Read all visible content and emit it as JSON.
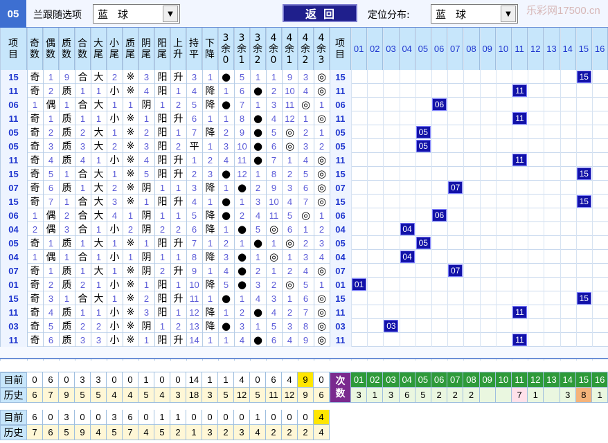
{
  "topbar": {
    "issue_num": "05",
    "follow_label": "兰跟随选项",
    "follow_value": "蓝球",
    "back_label": "返回",
    "position_label": "定位分布:",
    "position_value": "蓝球",
    "watermark": "乐彩网17500.cn"
  },
  "headers": [
    "项目",
    "奇数",
    "偶数",
    "质数",
    "合数",
    "大尾",
    "小尾",
    "质尾",
    "阴尾",
    "阳尾",
    "上升",
    "持平",
    "下降",
    "3余0",
    "3余1",
    "3余2",
    "4余0",
    "4余1",
    "4余2",
    "4余3",
    "项目"
  ],
  "dist_headers": [
    "01",
    "02",
    "03",
    "04",
    "05",
    "06",
    "07",
    "08",
    "09",
    "10",
    "11",
    "12",
    "13",
    "14",
    "15",
    "16"
  ],
  "rows": [
    {
      "n": "15",
      "v": [
        "奇",
        "1",
        "9",
        "合",
        "大",
        "2",
        "※",
        "3",
        "阳",
        "升",
        "3",
        "1",
        "●",
        "5",
        "1",
        "1",
        "9",
        "3",
        "◎"
      ]
    },
    {
      "n": "11",
      "v": [
        "奇",
        "2",
        "质",
        "1",
        "1",
        "小",
        "※",
        "4",
        "阳",
        "1",
        "4",
        "降",
        "1",
        "6",
        "●",
        "2",
        "10",
        "4",
        "◎"
      ]
    },
    {
      "n": "06",
      "v": [
        "1",
        "偶",
        "1",
        "合",
        "大",
        "1",
        "1",
        "阴",
        "1",
        "2",
        "5",
        "降",
        "●",
        "7",
        "1",
        "3",
        "11",
        "◎",
        "1"
      ]
    },
    {
      "n": "11",
      "v": [
        "奇",
        "1",
        "质",
        "1",
        "1",
        "小",
        "※",
        "1",
        "阳",
        "升",
        "6",
        "1",
        "1",
        "8",
        "●",
        "4",
        "12",
        "1",
        "◎"
      ]
    },
    {
      "n": "05",
      "v": [
        "奇",
        "2",
        "质",
        "2",
        "大",
        "1",
        "※",
        "2",
        "阳",
        "1",
        "7",
        "降",
        "2",
        "9",
        "●",
        "5",
        "◎",
        "2",
        "1"
      ]
    },
    {
      "n": "05",
      "v": [
        "奇",
        "3",
        "质",
        "3",
        "大",
        "2",
        "※",
        "3",
        "阳",
        "2",
        "平",
        "1",
        "3",
        "10",
        "●",
        "6",
        "◎",
        "3",
        "2"
      ]
    },
    {
      "n": "11",
      "v": [
        "奇",
        "4",
        "质",
        "4",
        "1",
        "小",
        "※",
        "4",
        "阳",
        "升",
        "1",
        "2",
        "4",
        "11",
        "●",
        "7",
        "1",
        "4",
        "◎"
      ]
    },
    {
      "n": "15",
      "v": [
        "奇",
        "5",
        "1",
        "合",
        "大",
        "1",
        "※",
        "5",
        "阳",
        "升",
        "2",
        "3",
        "●",
        "12",
        "1",
        "8",
        "2",
        "5",
        "◎"
      ]
    },
    {
      "n": "07",
      "v": [
        "奇",
        "6",
        "质",
        "1",
        "大",
        "2",
        "※",
        "阴",
        "1",
        "1",
        "3",
        "降",
        "1",
        "●",
        "2",
        "9",
        "3",
        "6",
        "◎"
      ]
    },
    {
      "n": "15",
      "v": [
        "奇",
        "7",
        "1",
        "合",
        "大",
        "3",
        "※",
        "1",
        "阳",
        "升",
        "4",
        "1",
        "●",
        "1",
        "3",
        "10",
        "4",
        "7",
        "◎"
      ]
    },
    {
      "n": "06",
      "v": [
        "1",
        "偶",
        "2",
        "合",
        "大",
        "4",
        "1",
        "阴",
        "1",
        "1",
        "5",
        "降",
        "●",
        "2",
        "4",
        "11",
        "5",
        "◎",
        "1"
      ]
    },
    {
      "n": "04",
      "v": [
        "2",
        "偶",
        "3",
        "合",
        "1",
        "小",
        "2",
        "阴",
        "2",
        "2",
        "6",
        "降",
        "1",
        "●",
        "5",
        "◎",
        "6",
        "1",
        "2"
      ]
    },
    {
      "n": "05",
      "v": [
        "奇",
        "1",
        "质",
        "1",
        "大",
        "1",
        "※",
        "1",
        "阳",
        "升",
        "7",
        "1",
        "2",
        "1",
        "●",
        "1",
        "◎",
        "2",
        "3"
      ]
    },
    {
      "n": "04",
      "v": [
        "1",
        "偶",
        "1",
        "合",
        "1",
        "小",
        "1",
        "阴",
        "1",
        "1",
        "8",
        "降",
        "3",
        "●",
        "1",
        "◎",
        "1",
        "3",
        "4"
      ]
    },
    {
      "n": "07",
      "v": [
        "奇",
        "1",
        "质",
        "1",
        "大",
        "1",
        "※",
        "阴",
        "2",
        "升",
        "9",
        "1",
        "4",
        "●",
        "2",
        "1",
        "2",
        "4",
        "◎"
      ]
    },
    {
      "n": "01",
      "v": [
        "奇",
        "2",
        "质",
        "2",
        "1",
        "小",
        "※",
        "1",
        "阳",
        "1",
        "10",
        "降",
        "5",
        "●",
        "3",
        "2",
        "◎",
        "5",
        "1"
      ]
    },
    {
      "n": "15",
      "v": [
        "奇",
        "3",
        "1",
        "合",
        "大",
        "1",
        "※",
        "2",
        "阳",
        "升",
        "11",
        "1",
        "●",
        "1",
        "4",
        "3",
        "1",
        "6",
        "◎"
      ]
    },
    {
      "n": "11",
      "v": [
        "奇",
        "4",
        "质",
        "1",
        "1",
        "小",
        "※",
        "3",
        "阳",
        "1",
        "12",
        "降",
        "1",
        "2",
        "●",
        "4",
        "2",
        "7",
        "◎"
      ]
    },
    {
      "n": "03",
      "v": [
        "奇",
        "5",
        "质",
        "2",
        "2",
        "小",
        "※",
        "阴",
        "1",
        "2",
        "13",
        "降",
        "●",
        "3",
        "1",
        "5",
        "3",
        "8",
        "◎"
      ]
    },
    {
      "n": "11",
      "v": [
        "奇",
        "6",
        "质",
        "3",
        "3",
        "小",
        "※",
        "1",
        "阳",
        "升",
        "14",
        "1",
        "1",
        "4",
        "●",
        "6",
        "4",
        "9",
        "◎"
      ]
    }
  ],
  "stats": {
    "current_label": "目前",
    "history_label": "历史",
    "current": [
      "0",
      "6",
      "0",
      "3",
      "3",
      "0",
      "0",
      "1",
      "0",
      "0",
      "14",
      "1",
      "1",
      "4",
      "0",
      "6",
      "4",
      "9",
      "0"
    ],
    "history": [
      "6",
      "7",
      "9",
      "5",
      "5",
      "4",
      "4",
      "5",
      "4",
      "3",
      "18",
      "3",
      "5",
      "12",
      "5",
      "11",
      "12",
      "9",
      "6"
    ],
    "times_label": "次数",
    "times": [
      "3",
      "1",
      "3",
      "6",
      "5",
      "2",
      "2",
      "2",
      "",
      "",
      "7",
      "1",
      "",
      "3",
      "8",
      "1"
    ]
  },
  "stats2": {
    "current_label": "目前",
    "history_label": "历史",
    "current": [
      "6",
      "0",
      "3",
      "0",
      "0",
      "3",
      "6",
      "0",
      "1",
      "1",
      "0",
      "0",
      "0",
      "0",
      "1",
      "0",
      "0",
      "0",
      "4"
    ],
    "history": [
      "7",
      "6",
      "5",
      "9",
      "4",
      "5",
      "7",
      "4",
      "5",
      "2",
      "1",
      "3",
      "2",
      "3",
      "4",
      "2",
      "2",
      "2",
      "4"
    ]
  },
  "colors": {
    "header_bg": "#c7e6fb",
    "hit_bg": "#1212a8",
    "times_bg": "#7a2a8e",
    "dist_header_bg": "#2e9a3a"
  }
}
